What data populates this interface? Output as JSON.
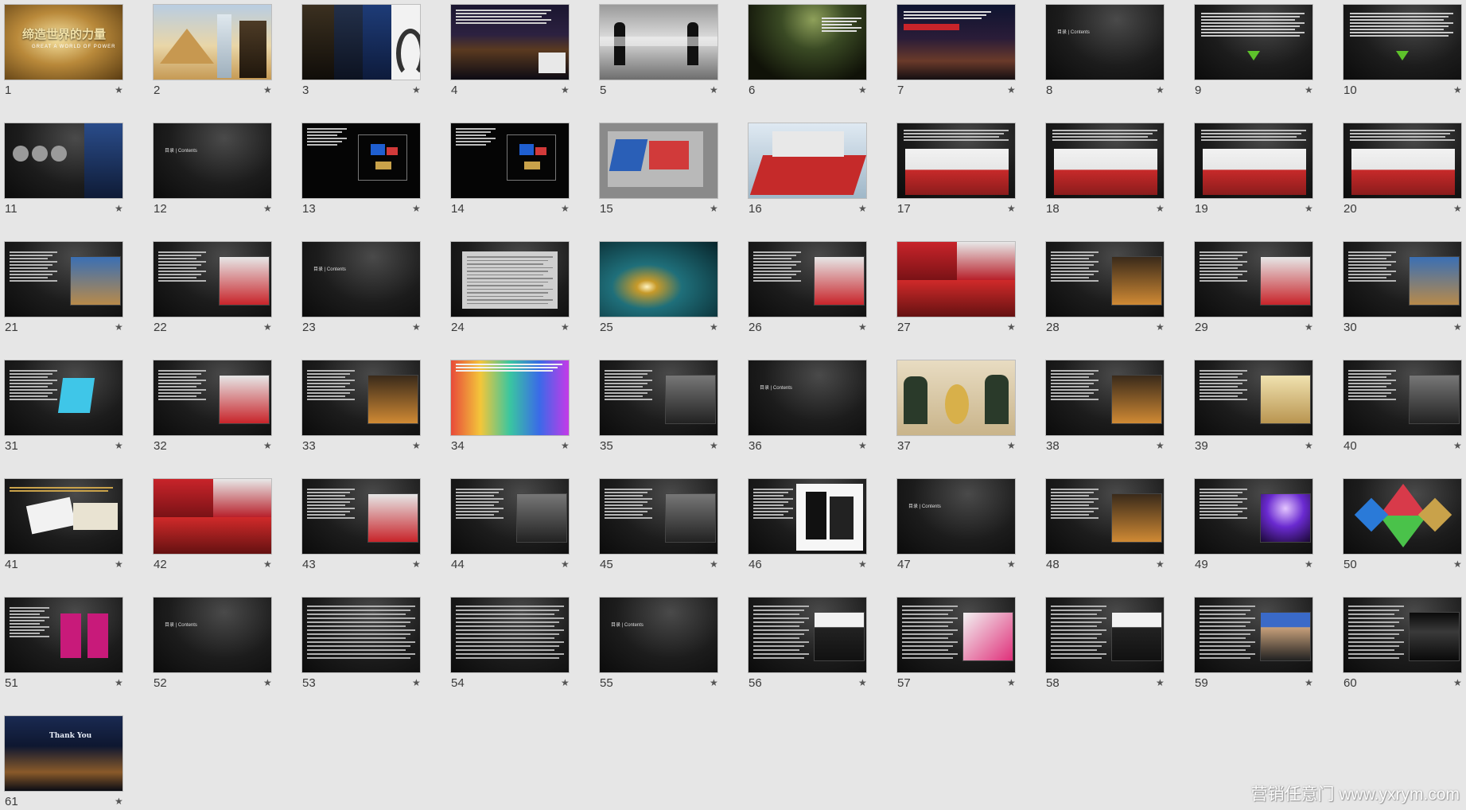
{
  "slides": [
    {
      "number": "1",
      "style": "gold",
      "title": "缔造世界的力量",
      "subtitle": "GREAT A WORLD OF POWER"
    },
    {
      "number": "2",
      "style": "photo-pyramid"
    },
    {
      "number": "3",
      "style": "photo-collage"
    },
    {
      "number": "4",
      "style": "night-city"
    },
    {
      "number": "5",
      "style": "grey-photo"
    },
    {
      "number": "6",
      "style": "dark-green"
    },
    {
      "number": "7",
      "style": "night-city-red"
    },
    {
      "number": "8",
      "style": "contents",
      "label": "目录 | Contents"
    },
    {
      "number": "9",
      "style": "text-green-arrow"
    },
    {
      "number": "10",
      "style": "text-green-arrow"
    },
    {
      "number": "11",
      "style": "text-city"
    },
    {
      "number": "12",
      "style": "contents",
      "label": "目录 | Contents"
    },
    {
      "number": "13",
      "style": "diagram-blue"
    },
    {
      "number": "14",
      "style": "diagram-blue"
    },
    {
      "number": "15",
      "style": "floorplan"
    },
    {
      "number": "16",
      "style": "stage-3d"
    },
    {
      "number": "17",
      "style": "stage-red"
    },
    {
      "number": "18",
      "style": "stage-red"
    },
    {
      "number": "19",
      "style": "stage-red"
    },
    {
      "number": "20",
      "style": "stage-red"
    },
    {
      "number": "21",
      "style": "text-photo-blue"
    },
    {
      "number": "22",
      "style": "text-photo-red"
    },
    {
      "number": "23",
      "style": "contents",
      "label": "目录 | Contents"
    },
    {
      "number": "24",
      "style": "text-table"
    },
    {
      "number": "25",
      "style": "puzzle"
    },
    {
      "number": "26",
      "style": "text-photo-red"
    },
    {
      "number": "27",
      "style": "collage-red"
    },
    {
      "number": "28",
      "style": "text-photo-orange"
    },
    {
      "number": "29",
      "style": "text-photo-red"
    },
    {
      "number": "30",
      "style": "text-photo-blue"
    },
    {
      "number": "31",
      "style": "text-photo-cyan"
    },
    {
      "number": "32",
      "style": "text-photo-red"
    },
    {
      "number": "33",
      "style": "text-photo-orange"
    },
    {
      "number": "34",
      "style": "colorful"
    },
    {
      "number": "35",
      "style": "text-photo-grey"
    },
    {
      "number": "36",
      "style": "contents",
      "label": "目录 | Contents"
    },
    {
      "number": "37",
      "style": "band"
    },
    {
      "number": "38",
      "style": "text-photo-orange"
    },
    {
      "number": "39",
      "style": "text-photo-gold"
    },
    {
      "number": "40",
      "style": "text-photo-grey"
    },
    {
      "number": "41",
      "style": "pens"
    },
    {
      "number": "42",
      "style": "collage-red"
    },
    {
      "number": "43",
      "style": "text-photo-red"
    },
    {
      "number": "44",
      "style": "text-photo-grey"
    },
    {
      "number": "45",
      "style": "text-photo-grey"
    },
    {
      "number": "46",
      "style": "speakers"
    },
    {
      "number": "47",
      "style": "contents",
      "label": "目录 | Contents"
    },
    {
      "number": "48",
      "style": "text-photo-orange"
    },
    {
      "number": "49",
      "style": "text-photo-purple"
    },
    {
      "number": "50",
      "style": "triangles"
    },
    {
      "number": "51",
      "style": "text-photo-pink"
    },
    {
      "number": "52",
      "style": "contents",
      "label": "目录 | Contents"
    },
    {
      "number": "53",
      "style": "text-only"
    },
    {
      "number": "54",
      "style": "text-only"
    },
    {
      "number": "55",
      "style": "contents",
      "label": "目录 | Contents"
    },
    {
      "number": "56",
      "style": "portrait"
    },
    {
      "number": "57",
      "style": "portrait-pink"
    },
    {
      "number": "58",
      "style": "portrait"
    },
    {
      "number": "59",
      "style": "portrait-blue"
    },
    {
      "number": "60",
      "style": "portrait-dark"
    },
    {
      "number": "61",
      "style": "thanks",
      "label": "Thank You"
    }
  ],
  "star_glyph": "★",
  "watermark": "营销任意门 www.yxrym.com",
  "colors": {
    "background": "#e6e6e6",
    "slide_dark": "#121212",
    "gold": "#c9a24a",
    "green_arrow": "#5ec22b",
    "red": "#c8242a"
  }
}
